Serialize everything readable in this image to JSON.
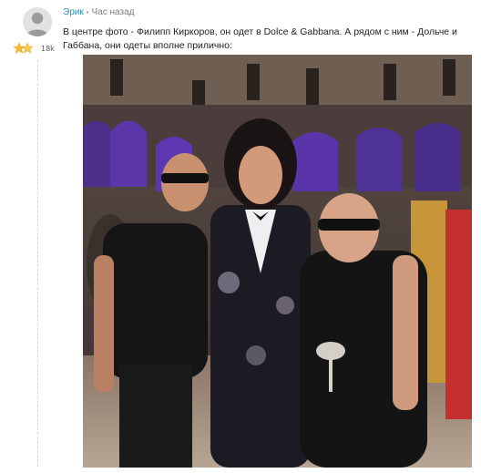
{
  "comment": {
    "author": "Эрик",
    "separator": "•",
    "time": "Час назад",
    "rating": "18k",
    "text": "В центре фото - Филипп Киркоров, он одет в Dolce & Gabbana. А рядом с ним - Дольче и Габбана, они одеты вполне прилично:"
  },
  "icons": {
    "avatar": "default-user-avatar",
    "rating": "gold-star-pair"
  }
}
